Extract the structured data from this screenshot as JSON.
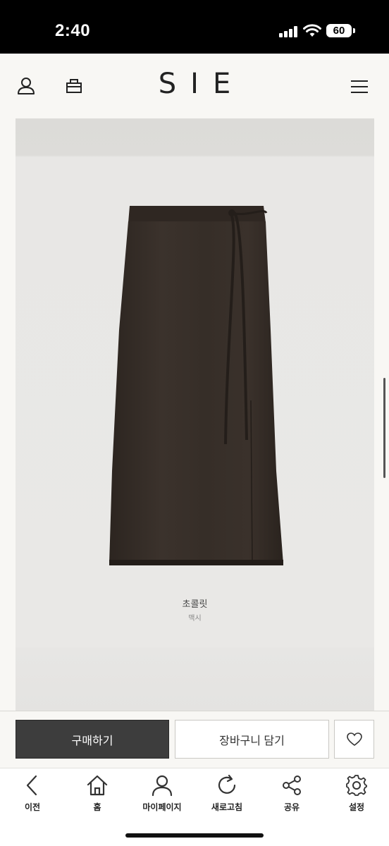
{
  "status_bar": {
    "time": "2:40",
    "battery": "60"
  },
  "header": {
    "brand": "SIE",
    "icons": [
      "user-icon",
      "bag-icon",
      "menu-icon"
    ]
  },
  "product": {
    "color_name": "초콜릿",
    "color_sub": "맥시"
  },
  "actions": {
    "buy_label": "구매하기",
    "cart_label": "장바구니 담기",
    "wish_icon": "heart-icon"
  },
  "bottom_nav": {
    "items": [
      {
        "label": "이전",
        "icon": "back-icon"
      },
      {
        "label": "홈",
        "icon": "home-icon"
      },
      {
        "label": "마이페이지",
        "icon": "user-icon"
      },
      {
        "label": "새로고침",
        "icon": "refresh-icon"
      },
      {
        "label": "공유",
        "icon": "share-icon"
      },
      {
        "label": "설정",
        "icon": "gear-icon"
      }
    ]
  }
}
